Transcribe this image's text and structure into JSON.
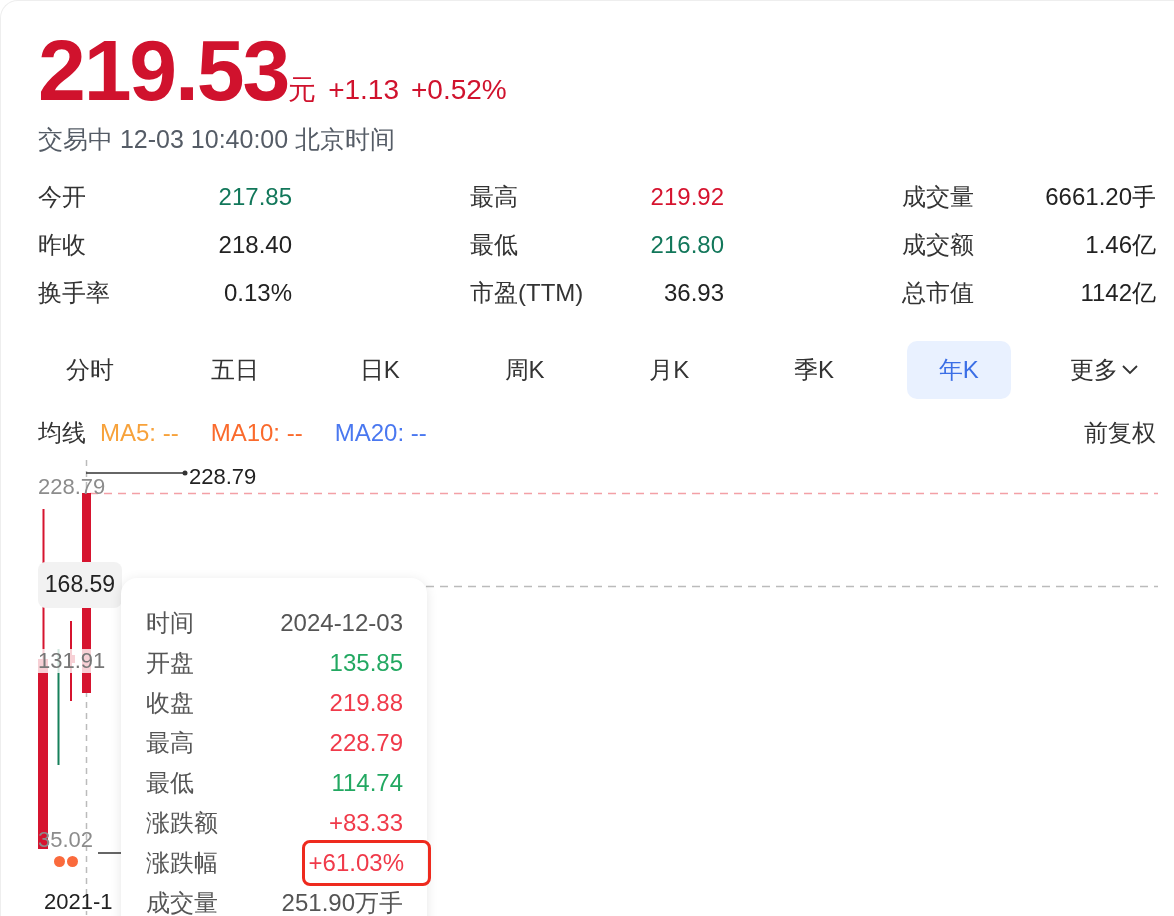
{
  "quote": {
    "price": "219.53",
    "unit": "元",
    "change": "+1.13",
    "change_pct": "+0.52%",
    "status": "交易中 12-03 10:40:00 北京时间"
  },
  "stats": [
    {
      "label": "今开",
      "value": "217.85",
      "color": "#12775a"
    },
    {
      "label": "最高",
      "value": "219.92",
      "color": "#d6142f"
    },
    {
      "label": "成交量",
      "value": "6661.20手",
      "color": "#222222"
    },
    {
      "label": "昨收",
      "value": "218.40",
      "color": "#222222"
    },
    {
      "label": "最低",
      "value": "216.80",
      "color": "#12775a"
    },
    {
      "label": "成交额",
      "value": "1.46亿",
      "color": "#222222"
    },
    {
      "label": "换手率",
      "value": "0.13%",
      "color": "#222222"
    },
    {
      "label": "市盈(TTM)",
      "value": "36.93",
      "color": "#222222"
    },
    {
      "label": "总市值",
      "value": "1142亿",
      "color": "#222222"
    }
  ],
  "tabs": [
    {
      "label": "分时",
      "selected": false
    },
    {
      "label": "五日",
      "selected": false
    },
    {
      "label": "日K",
      "selected": false
    },
    {
      "label": "周K",
      "selected": false
    },
    {
      "label": "月K",
      "selected": false
    },
    {
      "label": "季K",
      "selected": false
    },
    {
      "label": "年K",
      "selected": true
    },
    {
      "label": "更多",
      "selected": false,
      "kind": "dropdown"
    }
  ],
  "ma_legend": {
    "label": "均线",
    "items": [
      {
        "label": "MA5: --",
        "color": "#f7a23b"
      },
      {
        "label": "MA10: --",
        "color": "#fa6a2c"
      },
      {
        "label": "MA20: --",
        "color": "#4a78f0"
      }
    ],
    "adjust": "前复权"
  },
  "chart": {
    "axis_labels": [
      "228.79",
      "131.91",
      "35.02"
    ],
    "crosshair_price": "168.59",
    "high_marker": "228.79",
    "date_label": "2021-1",
    "tooltip": [
      {
        "label": "时间",
        "value": "2024-12-03",
        "color": "#555555",
        "highlighted": false
      },
      {
        "label": "开盘",
        "value": "135.85",
        "color": "#22a861",
        "highlighted": false
      },
      {
        "label": "收盘",
        "value": "219.88",
        "color": "#f03a4a",
        "highlighted": false
      },
      {
        "label": "最高",
        "value": "228.79",
        "color": "#f03a4a",
        "highlighted": false
      },
      {
        "label": "最低",
        "value": "114.74",
        "color": "#22a861",
        "highlighted": false
      },
      {
        "label": "涨跌额",
        "value": "+83.33",
        "color": "#f03a4a",
        "highlighted": false
      },
      {
        "label": "涨跌幅",
        "value": "+61.03%",
        "color": "#f03a4a",
        "highlighted": true
      },
      {
        "label": "成交量",
        "value": "251.90万手",
        "color": "#555555",
        "highlighted": false
      }
    ]
  }
}
